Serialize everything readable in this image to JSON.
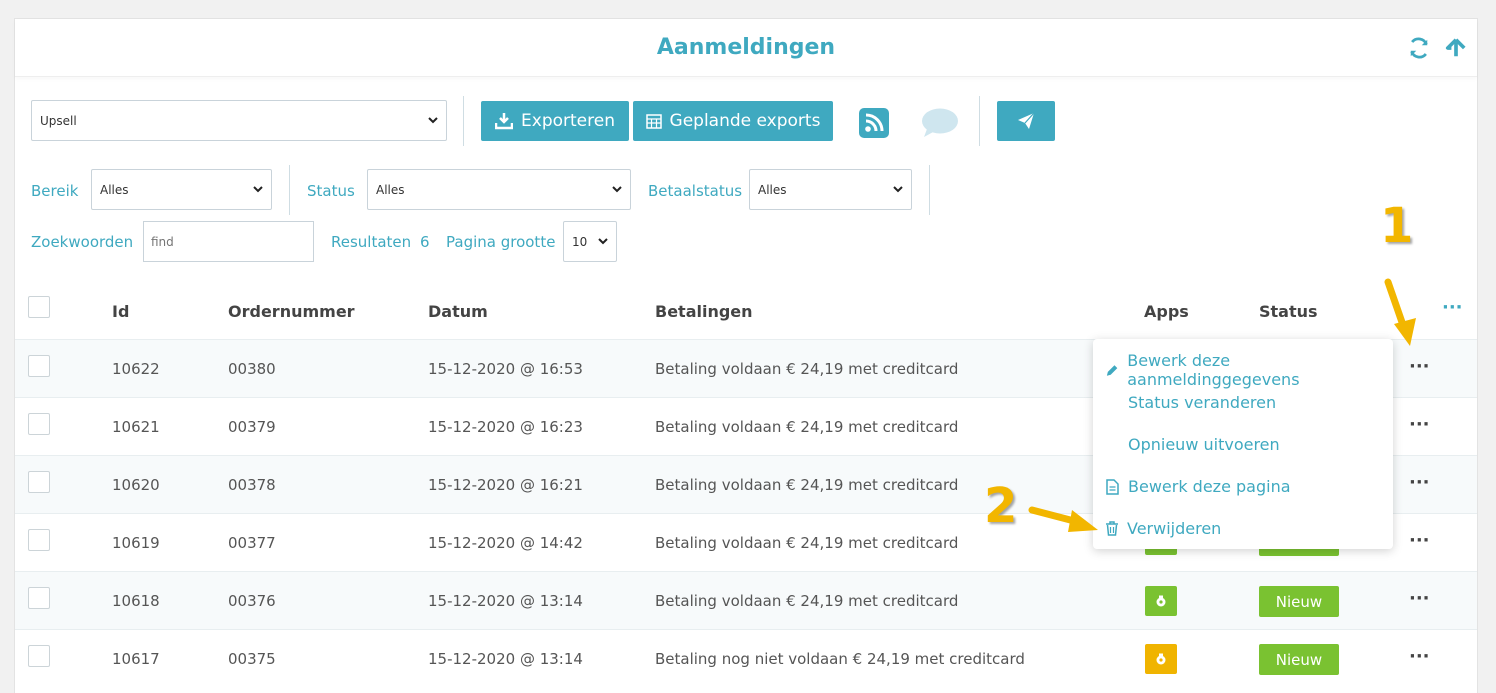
{
  "header": {
    "title": "Aanmeldingen",
    "icons": [
      "refresh-icon",
      "arrow-up-icon"
    ]
  },
  "toolbar": {
    "form_select": "Upsell",
    "export_label": "Exporteren",
    "scheduled_label": "Geplande exports",
    "icons": [
      "download-icon",
      "calendar-icon",
      "rss-icon",
      "chat-icon",
      "send-icon"
    ]
  },
  "filters": {
    "range_label": "Bereik",
    "range_value": "Alles",
    "status_label": "Status",
    "status_value": "Alles",
    "pay_label": "Betaalstatus",
    "pay_value": "Alles",
    "search_label": "Zoekwoorden",
    "search_placeholder": "find",
    "results_label": "Resultaten",
    "results_count": "6",
    "pagesize_label": "Pagina grootte",
    "pagesize_value": "10"
  },
  "table": {
    "columns": {
      "id": "Id",
      "order": "Ordernummer",
      "date": "Datum",
      "payments": "Betalingen",
      "apps": "Apps",
      "status": "Status"
    },
    "rows": [
      {
        "id": "10622",
        "order": "00380",
        "date": "15-12-2020 @ 16:53",
        "payment": "Betaling voldaan € 24,19 met creditcard"
      },
      {
        "id": "10621",
        "order": "00379",
        "date": "15-12-2020 @ 16:23",
        "payment": "Betaling voldaan € 24,19 met creditcard"
      },
      {
        "id": "10620",
        "order": "00378",
        "date": "15-12-2020 @ 16:21",
        "payment": "Betaling voldaan € 24,19 met creditcard"
      },
      {
        "id": "10619",
        "order": "00377",
        "date": "15-12-2020 @ 14:42",
        "payment": "Betaling voldaan € 24,19 met creditcard"
      },
      {
        "id": "10618",
        "order": "00376",
        "date": "15-12-2020 @ 13:14",
        "payment": "Betaling voldaan € 24,19 met creditcard",
        "app_color": "#7ac231",
        "status": "Nieuw"
      },
      {
        "id": "10617",
        "order": "00375",
        "date": "15-12-2020 @ 13:14",
        "payment": "Betaling nog niet voldaan € 24,19 met creditcard",
        "app_color": "#f0b400",
        "status": "Nieuw"
      }
    ]
  },
  "context_menu": {
    "items": [
      {
        "label": "Bewerk deze aanmeldinggegevens",
        "icon": "pencil-icon"
      },
      {
        "label": "Status veranderen"
      },
      {
        "label": "Opnieuw uitvoeren"
      },
      {
        "label": "Bewerk deze pagina",
        "icon": "document-icon"
      },
      {
        "label": "Verwijderen",
        "icon": "trash-icon"
      }
    ]
  },
  "annotations": {
    "one": "1",
    "two": "2"
  },
  "colors": {
    "accent": "#3fa9c0",
    "status_new": "#7ac231",
    "app_paid": "#7ac231",
    "app_unpaid": "#f0b400",
    "annotation": "#f2b600"
  }
}
